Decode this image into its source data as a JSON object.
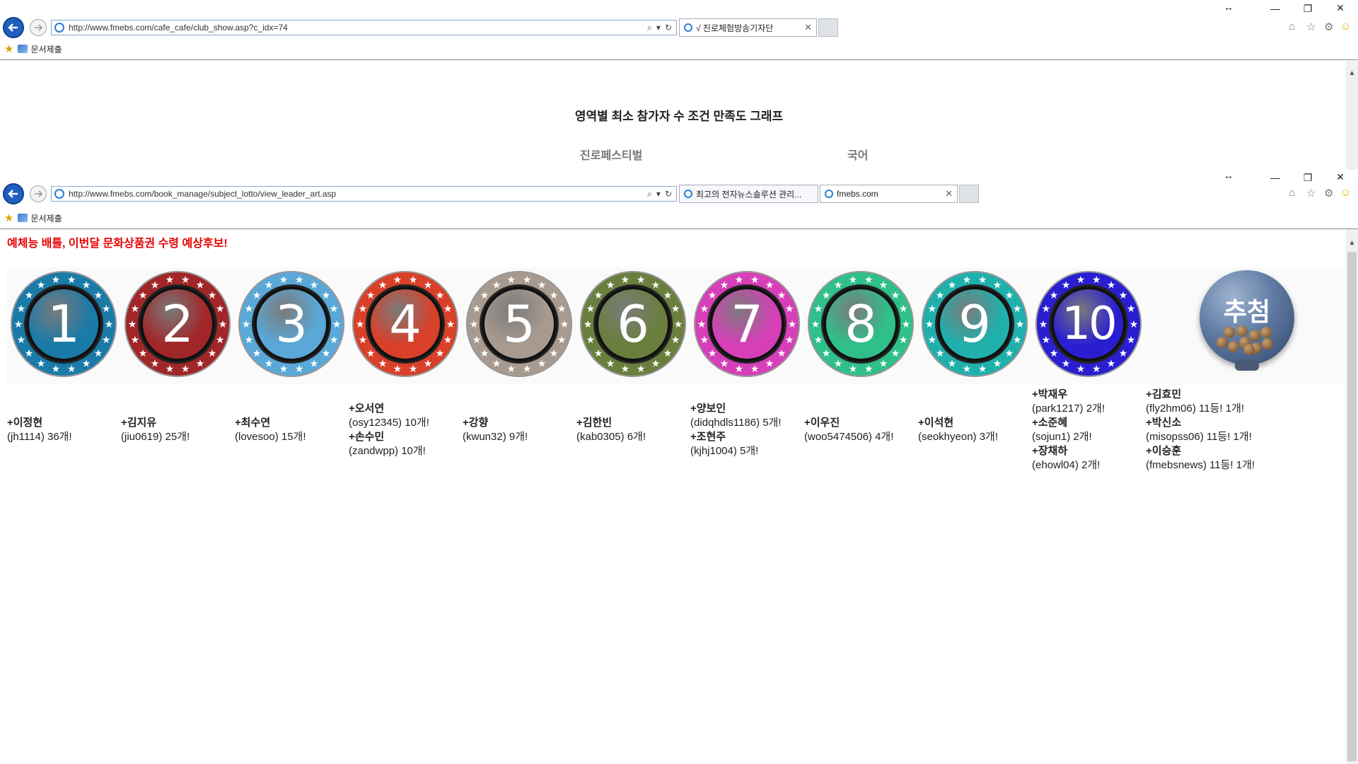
{
  "back_window": {
    "address_url": "http://www.fmebs.com/cafe_cafe/club_show.asp?c_idx=74",
    "tab_title": "√ 진로체험방송기자단",
    "favorites_item": "문서제출",
    "page_title": "영역별 최소 참가자 수 조건 만족도 그래프",
    "columns": [
      "진로페스티벌",
      "국어"
    ]
  },
  "front_window": {
    "address_url": "http://www.fmebs.com/book_manage/subject_lotto/view_leader_art.asp",
    "tabs": [
      {
        "title": "최고의 전자뉴스솔루션 관리...",
        "active": false
      },
      {
        "title": "fmebs.com",
        "active": true
      }
    ],
    "favorites_item": "문서제출"
  },
  "content": {
    "headline": "예체능 배틀, 이번달 문화상품권 수령 예상후보!",
    "badges": [
      {
        "number": "1",
        "color": "#1a7aa8"
      },
      {
        "number": "2",
        "color": "#a12628"
      },
      {
        "number": "3",
        "color": "#5aa8d8"
      },
      {
        "number": "4",
        "color": "#d8402a"
      },
      {
        "number": "5",
        "color": "#a89a8e"
      },
      {
        "number": "6",
        "color": "#6a7f3e"
      },
      {
        "number": "7",
        "color": "#d63fb8"
      },
      {
        "number": "8",
        "color": "#2fbf8a"
      },
      {
        "number": "9",
        "color": "#1fb0ac"
      },
      {
        "number": "10",
        "color": "#2a1fd0"
      }
    ],
    "lotto_label": "추첨",
    "winners": [
      {
        "lines": [
          {
            "t": "+이정현",
            "b": true
          },
          {
            "t": "(jh1114) 36개!",
            "b": false
          }
        ]
      },
      {
        "lines": [
          {
            "t": "+김지유",
            "b": true
          },
          {
            "t": "(jiu0619) 25개!",
            "b": false
          }
        ]
      },
      {
        "lines": [
          {
            "t": "+최수연",
            "b": true
          },
          {
            "t": "(lovesoo) 15개!",
            "b": false
          }
        ]
      },
      {
        "lines": [
          {
            "t": "+오서연",
            "b": true
          },
          {
            "t": "(osy12345) 10개!",
            "b": false
          },
          {
            "t": "+손수민",
            "b": true
          },
          {
            "t": "(zandwpp) 10개!",
            "b": false
          }
        ]
      },
      {
        "lines": [
          {
            "t": "+강향",
            "b": true
          },
          {
            "t": "(kwun32) 9개!",
            "b": false
          }
        ]
      },
      {
        "lines": [
          {
            "t": "+김한빈",
            "b": true
          },
          {
            "t": "(kab0305) 6개!",
            "b": false
          }
        ]
      },
      {
        "lines": [
          {
            "t": "+양보인",
            "b": true
          },
          {
            "t": "(didqhdls1186) 5개!",
            "b": false
          },
          {
            "t": "+조현주",
            "b": true
          },
          {
            "t": "(kjhj1004) 5개!",
            "b": false
          }
        ]
      },
      {
        "lines": [
          {
            "t": "+이우진",
            "b": true
          },
          {
            "t": "(woo5474506) 4개!",
            "b": false
          }
        ]
      },
      {
        "lines": [
          {
            "t": "+이석현",
            "b": true
          },
          {
            "t": "(seokhyeon) 3개!",
            "b": false
          }
        ]
      },
      {
        "lines": [
          {
            "t": "+박재우",
            "b": true
          },
          {
            "t": "(park1217) 2개!",
            "b": false
          },
          {
            "t": "+소준혜",
            "b": true
          },
          {
            "t": "(sojun1) 2개!",
            "b": false
          },
          {
            "t": "+장채하",
            "b": true
          },
          {
            "t": "(ehowl04) 2개!",
            "b": false
          }
        ]
      },
      {
        "lines": [
          {
            "t": "+김효민",
            "b": true
          },
          {
            "t": "(fly2hm06) 11등! 1개!",
            "b": false
          },
          {
            "t": "+박신소",
            "b": true
          },
          {
            "t": "(misopss06) 11등! 1개!",
            "b": false
          },
          {
            "t": "+이승훈",
            "b": true
          },
          {
            "t": "(fmebsnews) 11등! 1개!",
            "b": false
          }
        ]
      }
    ]
  }
}
